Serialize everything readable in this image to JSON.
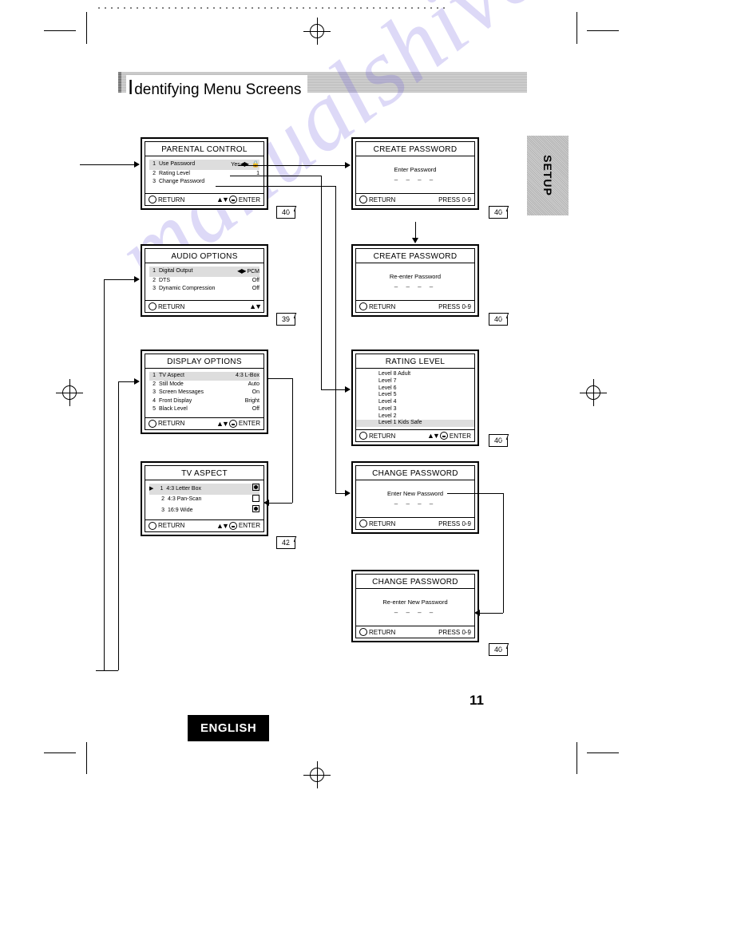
{
  "page": {
    "heading": "dentifying Menu Screens",
    "setup_tab": "SETUP",
    "page_number": "11",
    "language_badge": "ENGLISH"
  },
  "boxes": {
    "parental": {
      "title": "PARENTAL CONTROL",
      "items": [
        {
          "n": "1",
          "label": "Use Password",
          "value": "Yes",
          "lock": "🔒",
          "hl": true
        },
        {
          "n": "2",
          "label": "Rating Level",
          "value": "1"
        },
        {
          "n": "3",
          "label": "Change Password",
          "value": ""
        }
      ],
      "footer_left": "RETURN",
      "footer_right": "ENTER",
      "pageref": "40"
    },
    "audio": {
      "title": "AUDIO OPTIONS",
      "items": [
        {
          "n": "1",
          "label": "Digital Output",
          "value": "PCM",
          "hl": true
        },
        {
          "n": "2",
          "label": "DTS",
          "value": "Off"
        },
        {
          "n": "3",
          "label": "Dynamic Compression",
          "value": "Off"
        }
      ],
      "footer_left": "RETURN",
      "pageref": "39"
    },
    "display": {
      "title": "DISPLAY OPTIONS",
      "items": [
        {
          "n": "1",
          "label": "TV Aspect",
          "value": "4:3 L-Box",
          "hl": true
        },
        {
          "n": "2",
          "label": "Still Mode",
          "value": "Auto"
        },
        {
          "n": "3",
          "label": "Screen Messages",
          "value": "On"
        },
        {
          "n": "4",
          "label": "Front Display",
          "value": "Bright"
        },
        {
          "n": "5",
          "label": "Black Level",
          "value": "Off"
        }
      ],
      "footer_left": "RETURN",
      "footer_right": "ENTER"
    },
    "tvaspect": {
      "title": "TV ASPECT",
      "items": [
        {
          "n": "1",
          "label": "4:3 Letter Box",
          "selected": true,
          "hl": true
        },
        {
          "n": "2",
          "label": "4:3 Pan-Scan",
          "selected": false
        },
        {
          "n": "3",
          "label": "16:9 Wide",
          "selected": true
        }
      ],
      "footer_left": "RETURN",
      "footer_right": "ENTER",
      "pageref": "42"
    },
    "create_pw1": {
      "title": "CREATE PASSWORD",
      "prompt": "Enter Password",
      "dashes": "– – – –",
      "footer_left": "RETURN",
      "footer_right": "PRESS 0-9",
      "pageref": "40"
    },
    "create_pw2": {
      "title": "CREATE PASSWORD",
      "prompt": "Re-enter Password",
      "dashes": "– – – –",
      "footer_left": "RETURN",
      "footer_right": "PRESS 0-9",
      "pageref": "40"
    },
    "rating": {
      "title": "RATING LEVEL",
      "levels": [
        "Level 8 Adult",
        "Level 7",
        "Level 6",
        "Level 5",
        "Level 4",
        "Level 3",
        "Level 2",
        "Level 1 Kids Safe"
      ],
      "footer_left": "RETURN",
      "footer_right": "ENTER",
      "pageref": "40"
    },
    "change_pw1": {
      "title": "CHANGE PASSWORD",
      "prompt": "Enter New Password",
      "dashes": "– – – –",
      "footer_left": "RETURN",
      "footer_right": "PRESS 0-9"
    },
    "change_pw2": {
      "title": "CHANGE PASSWORD",
      "prompt": "Re-enter New Password",
      "dashes": "– – – –",
      "footer_left": "RETURN",
      "footer_right": "PRESS 0-9",
      "pageref": "40"
    }
  },
  "watermark": "manualshive.com"
}
